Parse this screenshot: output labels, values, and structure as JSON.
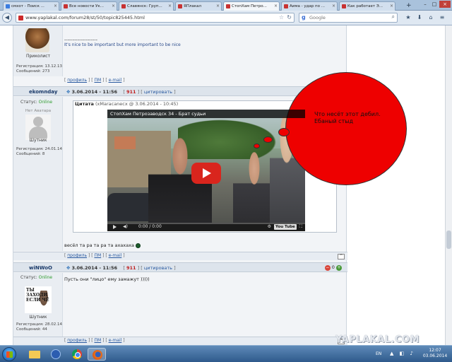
{
  "tabs": [
    {
      "label": "смхот - Поиск ...",
      "color": "#3b7de0"
    },
    {
      "label": "Все новости Ук...",
      "color": "#c83232"
    },
    {
      "label": "Славянск: Груп...",
      "color": "#c83232"
    },
    {
      "label": "ЯПлакал",
      "color": "#c83232"
    },
    {
      "label": "СтопХам Петро...",
      "color": "#c83232"
    },
    {
      "label": "Аима - удар по ...",
      "color": "#c83232"
    },
    {
      "label": "Как работает Э...",
      "color": "#c83232"
    }
  ],
  "tab_close_glyph": "×",
  "tab_new_glyph": "+",
  "window_buttons": {
    "minimize": "–",
    "maximize": "□",
    "close": "×"
  },
  "nav": {
    "url": "www.yaplakal.com/forum28/st/50/topic825445.html",
    "search_placeholder": "Google"
  },
  "posts": [
    {
      "rank": "Приколист",
      "registration": "Регистрация: 13.12.13",
      "messages": "Сообщений: 273",
      "signature_divider": "--------------------",
      "signature": "It's nice to be important but more important to be nice"
    },
    {
      "nick": "ekomnday",
      "date": "3.06.2014 - 11:56",
      "number": "911",
      "quote_action": "цитировать",
      "status_label": "Статус:",
      "status_value": "Online",
      "avatar_text": "Нет Аватара",
      "rank": "Шутник",
      "registration": "Регистрация: 24.01.14",
      "messages": "Сообщений: 8",
      "quote_label": "Цитата",
      "quote_source": "(хMaracanecx @ 3.06.2014 - 10:45)",
      "video_title": "СтопХам Петрозаводск 34 - Брат судьи",
      "video_time": "0:00 / 0:00",
      "video_logo": "You Tube",
      "body": "весёл та ра та ра та ахахаха"
    },
    {
      "nick": "wiNWoO",
      "date": "3.06.2014 - 11:56",
      "number": "911",
      "quote_action": "цитировать",
      "status_label": "Статус:",
      "status_value": "Online",
      "avatar_text": "ТЫ ЗАХОДИ ЕСЛИ ЧЁ",
      "rank": "Шутник",
      "registration": "Регистрация: 28.02.14",
      "messages": "Сообщений: 44",
      "body": "Пусть они \"лицо\" ему замажут )))))",
      "rating_value": "0"
    }
  ],
  "actions": {
    "profile": "профиль",
    "pm": "ПМ",
    "email": "e-mail"
  },
  "annotation": {
    "text": "Что несёт этот дебил. Ебаный стыд",
    "color": "#ee0000"
  },
  "watermark": "YAPLAKAL.COM",
  "taskbar": {
    "language": "EN",
    "time": "12:07",
    "date": "03.06.2014",
    "tray_glyphs": "▲ ◧ ♪"
  }
}
